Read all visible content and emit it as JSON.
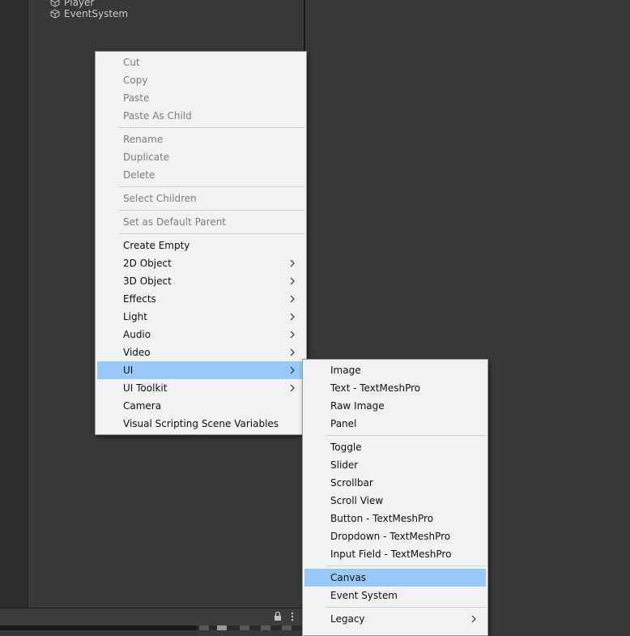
{
  "hierarchy": {
    "items": [
      {
        "label": "Player",
        "icon": "gameobject-cube-icon"
      },
      {
        "label": "EventSystem",
        "icon": "gameobject-cube-icon"
      }
    ]
  },
  "context_menu": {
    "items": [
      {
        "label": "Cut",
        "enabled": false
      },
      {
        "label": "Copy",
        "enabled": false
      },
      {
        "label": "Paste",
        "enabled": false
      },
      {
        "label": "Paste As Child",
        "enabled": false
      },
      {
        "label": "Rename",
        "enabled": false
      },
      {
        "label": "Duplicate",
        "enabled": false
      },
      {
        "label": "Delete",
        "enabled": false
      },
      {
        "label": "Select Children",
        "enabled": false
      },
      {
        "label": "Set as Default Parent",
        "enabled": false
      },
      {
        "label": "Create Empty",
        "enabled": true
      },
      {
        "label": "2D Object",
        "enabled": true,
        "submenu": true
      },
      {
        "label": "3D Object",
        "enabled": true,
        "submenu": true
      },
      {
        "label": "Effects",
        "enabled": true,
        "submenu": true
      },
      {
        "label": "Light",
        "enabled": true,
        "submenu": true
      },
      {
        "label": "Audio",
        "enabled": true,
        "submenu": true
      },
      {
        "label": "Video",
        "enabled": true,
        "submenu": true
      },
      {
        "label": "UI",
        "enabled": true,
        "submenu": true,
        "highlighted": true
      },
      {
        "label": "UI Toolkit",
        "enabled": true,
        "submenu": true
      },
      {
        "label": "Camera",
        "enabled": true
      },
      {
        "label": "Visual Scripting Scene Variables",
        "enabled": true
      }
    ]
  },
  "ui_submenu": {
    "items": [
      {
        "label": "Image"
      },
      {
        "label": "Text - TextMeshPro"
      },
      {
        "label": "Raw Image"
      },
      {
        "label": "Panel"
      },
      {
        "label": "Toggle"
      },
      {
        "label": "Slider"
      },
      {
        "label": "Scrollbar"
      },
      {
        "label": "Scroll View"
      },
      {
        "label": "Button - TextMeshPro"
      },
      {
        "label": "Dropdown - TextMeshPro"
      },
      {
        "label": "Input Field - TextMeshPro"
      },
      {
        "label": "Canvas",
        "highlighted": true
      },
      {
        "label": "Event System"
      },
      {
        "label": "Legacy",
        "submenu": true
      }
    ]
  },
  "colors": {
    "highlight": "#99c9f9",
    "menu_bg": "#f2f2f2",
    "editor_bg": "#383838",
    "disabled_text": "#7c7c7c"
  },
  "bottom_bar": {
    "icons": [
      "lock-icon",
      "kebab-menu-icon"
    ]
  }
}
